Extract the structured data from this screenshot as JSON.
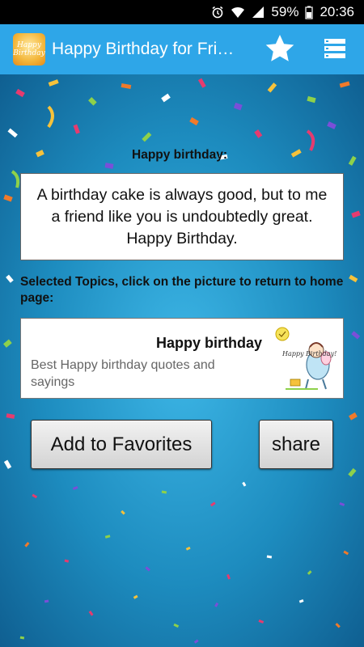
{
  "status_bar": {
    "battery": "59%",
    "time": "20:36"
  },
  "app_bar": {
    "title": "Happy Birthday for Fri…",
    "logo_text": "Happy Birthday"
  },
  "main": {
    "quote_heading": "Happy birthday:",
    "quote_text": "A birthday cake is always good, but to me a friend like you is undoubtedly great. Happy Birthday.",
    "topics_heading": "Selected Topics, click on the picture to return to home page:",
    "topic": {
      "title": "Happy birthday",
      "description": "Best Happy birthday quotes and sayings",
      "image_text": "Happy Birthday!"
    },
    "favorites_button": "Add to Favorites",
    "share_button": "share"
  },
  "colors": {
    "app_bar": "#2ea6e8",
    "background": "#1d8cbf"
  }
}
